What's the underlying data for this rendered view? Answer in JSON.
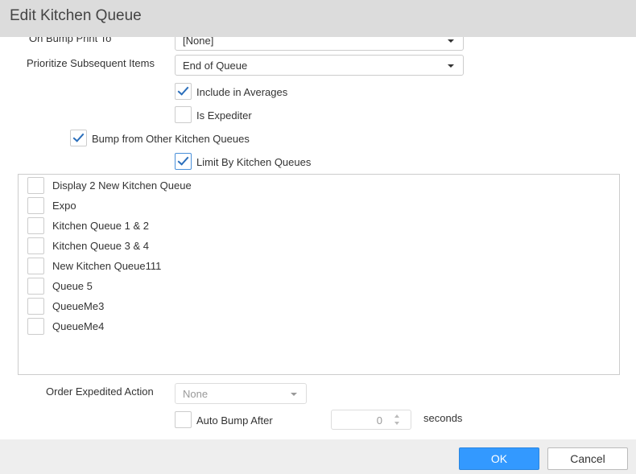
{
  "dialog": {
    "title": "Edit Kitchen Queue"
  },
  "form": {
    "on_bump_print_to": {
      "label": "On Bump Print To",
      "value": "[None]"
    },
    "prioritize_subsequent_items": {
      "label": "Prioritize Subsequent Items",
      "value": "End of Queue"
    },
    "include_in_averages": {
      "label": "Include in Averages",
      "checked": true
    },
    "is_expediter": {
      "label": "Is Expediter",
      "checked": false
    },
    "bump_from_other_kitchen_queues": {
      "label": "Bump from Other Kitchen Queues",
      "checked": true
    },
    "limit_by_kitchen_queues": {
      "label": "Limit By Kitchen Queues",
      "checked": true
    },
    "kitchen_queues": [
      {
        "label": "Display 2 New Kitchen Queue",
        "checked": false
      },
      {
        "label": "Expo",
        "checked": false
      },
      {
        "label": "Kitchen Queue 1 & 2",
        "checked": false
      },
      {
        "label": "Kitchen Queue 3 & 4",
        "checked": false
      },
      {
        "label": "New Kitchen Queue111",
        "checked": false
      },
      {
        "label": "Queue 5",
        "checked": false
      },
      {
        "label": "QueueMe3",
        "checked": false
      },
      {
        "label": "QueueMe4",
        "checked": false
      }
    ],
    "order_expedited_action": {
      "label": "Order Expedited Action",
      "value": "None",
      "disabled": true
    },
    "auto_bump_after": {
      "label": "Auto Bump After",
      "checked": false,
      "value": "0",
      "unit": "seconds"
    }
  },
  "footer": {
    "ok_label": "OK",
    "cancel_label": "Cancel"
  },
  "colors": {
    "accent": "#3399ff",
    "check": "#2a6ebb",
    "titlebar": "#dcdcdc",
    "footer": "#eeeeee"
  }
}
